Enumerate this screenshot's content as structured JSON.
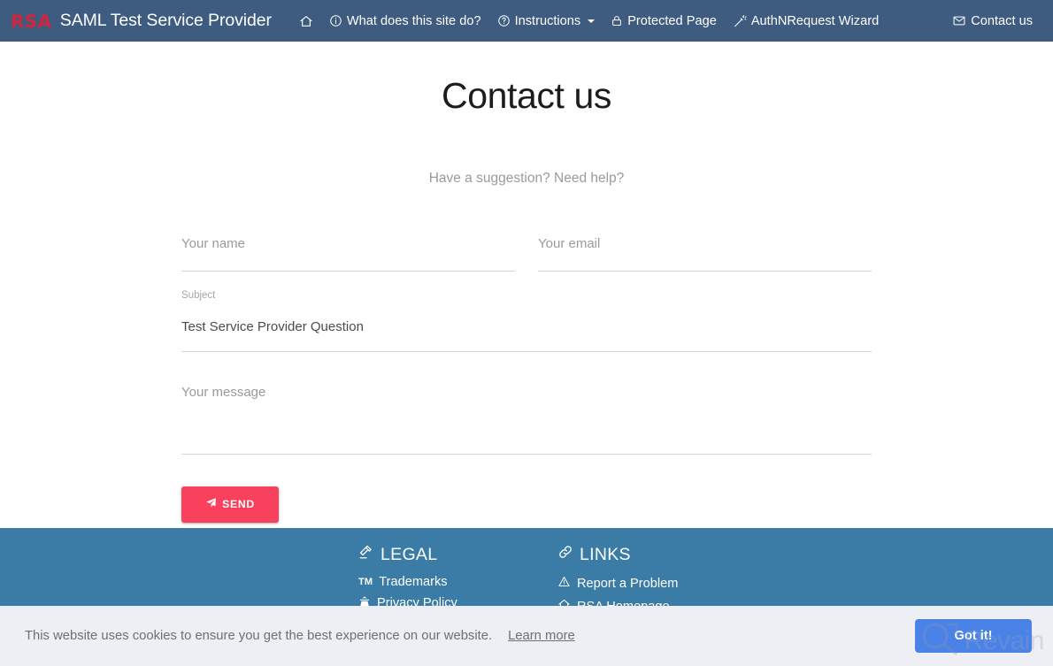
{
  "navbar": {
    "logo_text": "RSA",
    "brand_title": "SAML Test Service Provider",
    "home_icon": "home-icon",
    "items": [
      {
        "label": "What does this site do?",
        "icon": "info-circle-icon",
        "caret": false
      },
      {
        "label": "Instructions",
        "icon": "question-circle-icon",
        "caret": true
      },
      {
        "label": "Protected Page",
        "icon": "lock-icon",
        "caret": false
      },
      {
        "label": "AuthNRequest Wizard",
        "icon": "magic-wand-icon",
        "caret": false
      }
    ],
    "contact": {
      "label": "Contact us",
      "icon": "envelope-icon"
    },
    "colors": {
      "background": "#3e5b80",
      "logo": "#d2243c",
      "text": "#ffffff"
    }
  },
  "main": {
    "title": "Contact us",
    "subtitle": "Have a suggestion? Need help?",
    "form": {
      "name": {
        "label": "Your name",
        "value": ""
      },
      "email": {
        "label": "Your email",
        "value": ""
      },
      "subject": {
        "label": "Subject",
        "value": "Test Service Provider Question"
      },
      "message": {
        "label": "Your message",
        "value": ""
      },
      "send_button": {
        "label": "SEND",
        "icon": "paper-plane-icon",
        "color": "#f9415d"
      }
    }
  },
  "footer": {
    "background": "#3a7ca5",
    "columns": [
      {
        "heading": "LEGAL",
        "heading_icon": "gavel-icon",
        "links": [
          {
            "label": "Trademarks",
            "icon": "trademark-icon"
          },
          {
            "label": "Privacy Policy",
            "icon": "user-secret-icon"
          }
        ]
      },
      {
        "heading": "LINKS",
        "heading_icon": "link-icon",
        "links": [
          {
            "label": "Report a Problem",
            "icon": "warning-triangle-icon"
          },
          {
            "label": "RSA Homepage",
            "icon": "home-icon"
          }
        ]
      }
    ]
  },
  "cookie_banner": {
    "message": "This website uses cookies to ensure you get the best experience on our website.",
    "learn_more": "Learn more",
    "accept_button": "Got it!",
    "button_color": "#4a82e8",
    "background": "#edeff5"
  },
  "watermark": {
    "text": "Revain",
    "icon": "revain-logo-icon"
  }
}
